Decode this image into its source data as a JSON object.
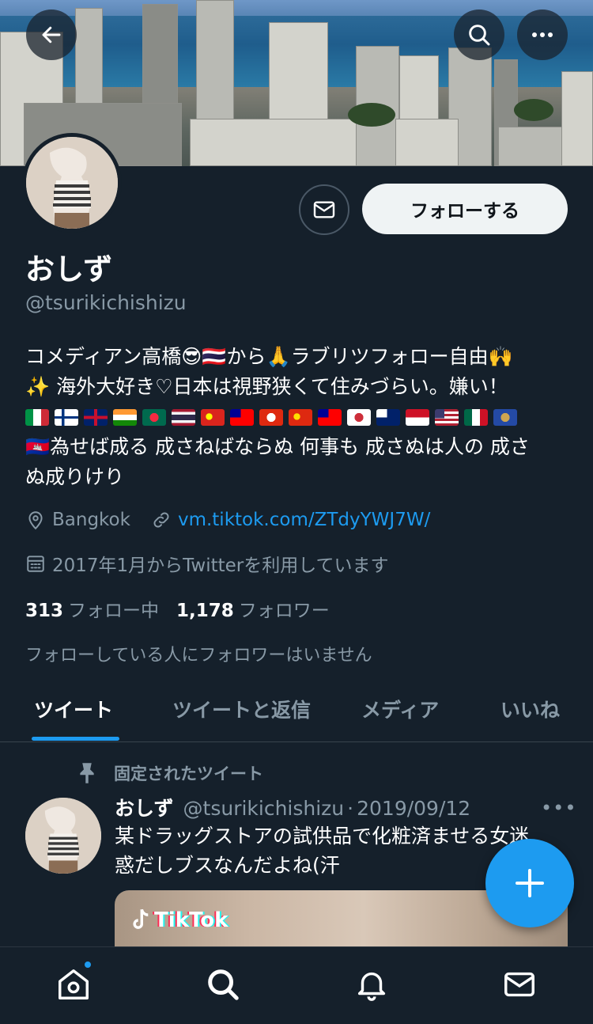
{
  "header": {
    "back_icon": "arrow-left-icon",
    "search_icon": "search-icon",
    "more_icon": "more-horizontal-icon"
  },
  "profile": {
    "display_name": "おしず",
    "handle": "@tsurikichishizu",
    "follow_label": "フォローする",
    "message_icon": "envelope-icon",
    "bio_line1": "コメディアン高橋😎🇹🇭から🙏ラブリツフォロー自由🙌",
    "bio_line2": "✨ 海外大好き♡日本は視野狭くて住みづらい。嫌い！",
    "bio_flags": [
      {
        "name": "italy-flag",
        "colors": [
          "#009246",
          "#ffffff",
          "#ce2b37"
        ],
        "style": "v3"
      },
      {
        "name": "finland-flag",
        "colors": [
          "#ffffff",
          "#003580"
        ],
        "style": "cross"
      },
      {
        "name": "uk-flag",
        "colors": [
          "#012169",
          "#c8102e",
          "#ffffff"
        ],
        "style": "uk"
      },
      {
        "name": "india-flag",
        "colors": [
          "#ff9933",
          "#ffffff",
          "#138808"
        ],
        "style": "h3"
      },
      {
        "name": "bangladesh-flag",
        "colors": [
          "#006a4e",
          "#f42a41"
        ],
        "style": "disc"
      },
      {
        "name": "thailand-flag",
        "colors": [
          "#a51931",
          "#f4f5f8",
          "#2d2a4a"
        ],
        "style": "thai"
      },
      {
        "name": "vietnam-flag",
        "colors": [
          "#da251d",
          "#ffff00"
        ],
        "style": "star"
      },
      {
        "name": "taiwan-flag",
        "colors": [
          "#fe0000",
          "#000095"
        ],
        "style": "canton"
      },
      {
        "name": "hong-kong-flag",
        "colors": [
          "#de2910",
          "#ffffff"
        ],
        "style": "disc"
      },
      {
        "name": "china-flag",
        "colors": [
          "#de2910",
          "#ffde00"
        ],
        "style": "star"
      },
      {
        "name": "taiwan-flag-2",
        "colors": [
          "#fe0000",
          "#000095"
        ],
        "style": "canton"
      },
      {
        "name": "korea-flag",
        "colors": [
          "#ffffff",
          "#cd2e3a"
        ],
        "style": "disc"
      },
      {
        "name": "australia-flag",
        "colors": [
          "#012169",
          "#ffffff"
        ],
        "style": "canton"
      },
      {
        "name": "indonesia-flag",
        "colors": [
          "#ce1126",
          "#ffffff"
        ],
        "style": "h2"
      },
      {
        "name": "usa-flag",
        "colors": [
          "#b22234",
          "#ffffff",
          "#3c3b6e"
        ],
        "style": "usa"
      },
      {
        "name": "mexico-flag",
        "colors": [
          "#006847",
          "#ffffff",
          "#ce1126"
        ],
        "style": "v3"
      },
      {
        "name": "kosovo-flag",
        "colors": [
          "#244aa5",
          "#d0a650"
        ],
        "style": "disc"
      }
    ],
    "bio_line4": "🇰🇭為せば成る 成さねばならぬ 何事も 成さぬは人の 成さ",
    "bio_line5": "ぬ成りけり",
    "location_icon": "map-pin-icon",
    "location": "Bangkok",
    "link_icon": "link-icon",
    "website": "vm.tiktok.com/ZTdyYWJ7W/",
    "calendar_icon": "calendar-icon",
    "joined": "2017年1月からTwitterを利用しています",
    "following_count": "313",
    "following_label": "フォロー中",
    "followers_count": "1,178",
    "followers_label": "フォロワー",
    "followers_note": "フォローしている人にフォロワーはいません"
  },
  "tabs": [
    {
      "label": "ツイート",
      "active": true
    },
    {
      "label": "ツイートと返信",
      "active": false
    },
    {
      "label": "メディア",
      "active": false
    },
    {
      "label": "いいね",
      "active": false
    }
  ],
  "pinned_tweet": {
    "pin_icon": "pin-icon",
    "pinned_label": "固定されたツイート",
    "author_name": "おしず",
    "author_handle": "@tsurikichishizu",
    "separator": "·",
    "date": "2019/09/12",
    "more": "•••",
    "text_line1": "某ドラッグストアの試供品で化粧済ませる女迷",
    "text_line2": "惑だしブスなんだよね(汗",
    "media_label": "TikTok"
  },
  "fab": {
    "icon": "plus-icon"
  },
  "bottom_nav": {
    "items": [
      "home-icon",
      "search-icon",
      "notifications-bell-icon",
      "messages-envelope-icon"
    ],
    "accent": "#1d9bf0"
  },
  "colors": {
    "background": "#15202b",
    "secondary_text": "#8899a6",
    "accent": "#1d9bf0"
  }
}
